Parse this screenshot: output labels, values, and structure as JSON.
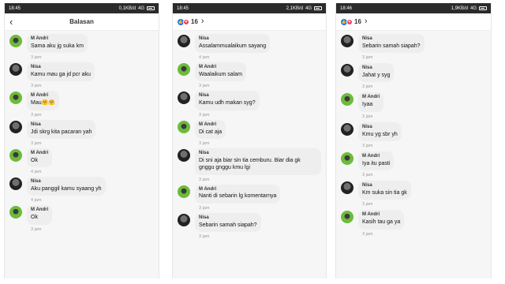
{
  "panels": [
    {
      "status": {
        "time": "18:45",
        "network": "0,1KB/d",
        "signal": "4G"
      },
      "header": {
        "title": "Balasan"
      },
      "messages": [
        {
          "sender": "M Andri",
          "avatar": "andri",
          "text": "Sama aku jg suka km",
          "time": "3 jam"
        },
        {
          "sender": "Nisa",
          "avatar": "nisa",
          "text": "Kamu mau ga jd pcr aku",
          "time": "3 jam"
        },
        {
          "sender": "M Andri",
          "avatar": "andri",
          "text": "Mau🤗🤗",
          "time": "3 jam"
        },
        {
          "sender": "Nisa",
          "avatar": "nisa",
          "text": "Jdi skrg kita pacaran yah",
          "time": "3 jam"
        },
        {
          "sender": "M Andri",
          "avatar": "andri",
          "text": "Ok",
          "time": "4 jam"
        },
        {
          "sender": "Nisa",
          "avatar": "nisa",
          "text": "Aku panggil kamu syaang yh",
          "time": "4 jam"
        },
        {
          "sender": "M Andri",
          "avatar": "andri",
          "text": "Ok",
          "time": "3 jam"
        }
      ]
    },
    {
      "status": {
        "time": "18:45",
        "network": "2,1KB/d",
        "signal": "4G"
      },
      "header": {
        "reaction_count": "16"
      },
      "messages": [
        {
          "sender": "Nisa",
          "avatar": "nisa",
          "text": "Assalammualaikum sayang",
          "time": "4 jam"
        },
        {
          "sender": "M Andri",
          "avatar": "andri",
          "text": "Waalaikum salam",
          "time": "3 jam"
        },
        {
          "sender": "Nisa",
          "avatar": "nisa",
          "text": "Kamu udh makan syg?",
          "time": "3 jam"
        },
        {
          "sender": "M Andri",
          "avatar": "andri",
          "text": "Di cat aja",
          "time": "3 jam"
        },
        {
          "sender": "Nisa",
          "avatar": "nisa",
          "text": "Di sni aja biar sin tia cemburu. Biar dia gk gnggu gnggu kmu lgi",
          "time": "3 jam"
        },
        {
          "sender": "M Andri",
          "avatar": "andri",
          "text": "Nanti di sebarin lg komentarnya",
          "time": "3 jam"
        },
        {
          "sender": "Nisa",
          "avatar": "nisa",
          "text": "Sebarin samah siapah?",
          "time": "3 jam"
        }
      ]
    },
    {
      "status": {
        "time": "18:46",
        "network": "1,9KB/d",
        "signal": "4G"
      },
      "header": {
        "reaction_count": "16"
      },
      "messages": [
        {
          "sender": "Nisa",
          "avatar": "nisa",
          "text": "Sebarin samah siapah?",
          "time": "3 jam"
        },
        {
          "sender": "Nisa",
          "avatar": "nisa",
          "text": "Jahat y syg",
          "time": "3 jam"
        },
        {
          "sender": "M Andri",
          "avatar": "andri",
          "text": "Iyaa",
          "time": "3 jam"
        },
        {
          "sender": "Nisa",
          "avatar": "nisa",
          "text": "Kmu yg sbr yh",
          "time": "3 jam"
        },
        {
          "sender": "M Andri",
          "avatar": "andri",
          "text": "Iya itu pasti",
          "time": "3 jam"
        },
        {
          "sender": "Nisa",
          "avatar": "nisa",
          "text": "Km suka sin tia gk",
          "time": "3 jam"
        },
        {
          "sender": "M Andri",
          "avatar": "andri",
          "text": "Kasih tau ga ya",
          "time": "3 jam"
        }
      ]
    }
  ]
}
